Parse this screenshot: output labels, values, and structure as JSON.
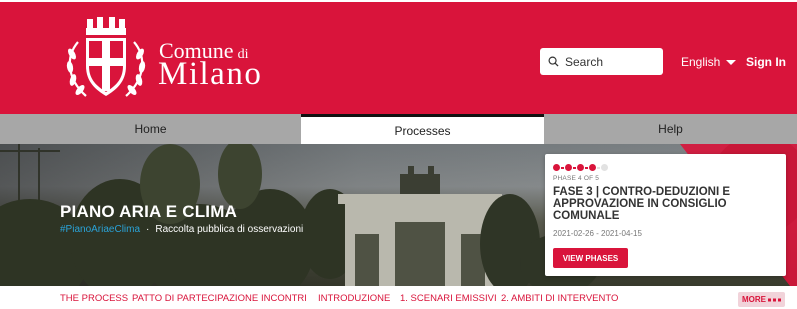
{
  "header": {
    "logo_line1": "Comune",
    "logo_line1_small": "di",
    "logo_line2": "Milano",
    "search_placeholder": "Search",
    "language": "English",
    "sign_in": "Sign In",
    "brand_color": "#d9143b"
  },
  "nav": {
    "items": [
      {
        "label": "Home",
        "active": false
      },
      {
        "label": "Processes",
        "active": true
      },
      {
        "label": "Help",
        "active": false
      }
    ]
  },
  "hero": {
    "title": "PIANO ARIA E CLIMA",
    "hashtag": "#PianoAriaeClima",
    "separator": "·",
    "description": "Raccolta pubblica di osservazioni",
    "phase_card": {
      "progress_current": 4,
      "progress_total": 5,
      "phase_of": "PHASE 4 OF 5",
      "phase_name": "FASE 3 | CONTRO-DEDUZIONI E APPROVAZIONE IN CONSIGLIO COMUNALE",
      "dates": "2021-02-26 - 2021-04-15",
      "button_label": "VIEW PHASES"
    }
  },
  "subnav": {
    "items": [
      "THE PROCESS",
      "PATTO DI PARTECIPAZIONE",
      "INCONTRI",
      "INTRODUZIONE",
      "1. SCENARI EMISSIVI",
      "2. AMBITI DI INTERVENTO"
    ],
    "more_label": "MORE",
    "more_icon": "ellipsis-icon"
  },
  "icons": {
    "search": "search-icon",
    "language_caret": "caret-down-icon",
    "crest": "milan-crest-icon"
  }
}
